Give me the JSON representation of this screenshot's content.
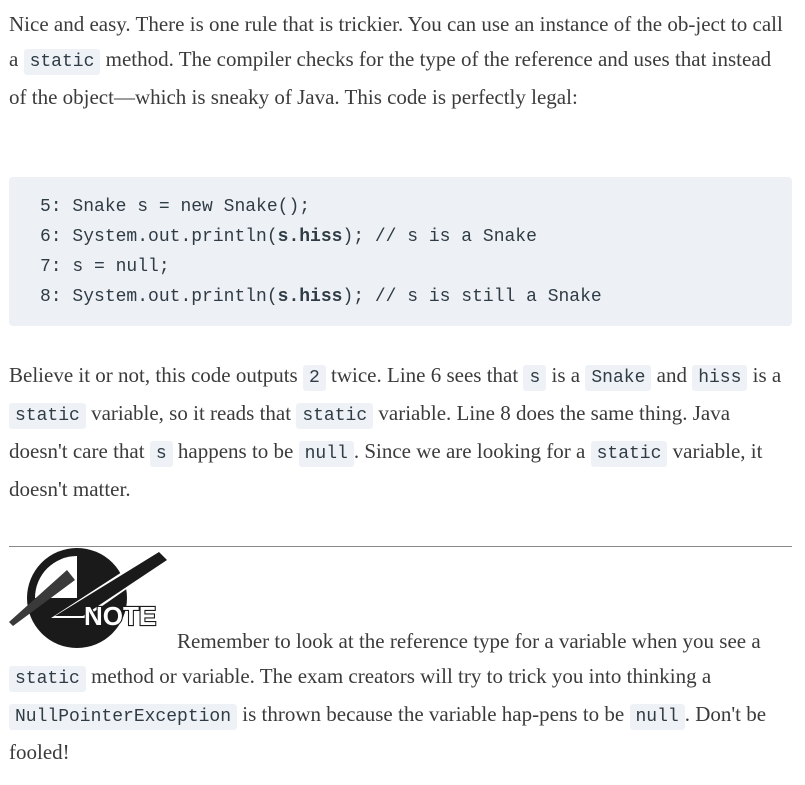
{
  "intro": {
    "t1": "Nice and easy. There is one rule that is trickier. You can use an instance of the ob-ject to call a ",
    "c1": "static",
    "t2": " method. The compiler checks for the type of the reference and uses that instead of the object—which is sneaky of Java. This code is perfectly legal:"
  },
  "code": {
    "line5": {
      "num": "5:",
      "text": "Snake s = new Snake();"
    },
    "line6": {
      "num": "6:",
      "pre": "System.out.println(",
      "bold": "s.hiss",
      "post": "); // s is a Snake"
    },
    "line7": {
      "num": "7:",
      "text": "s = null;"
    },
    "line8": {
      "num": "8:",
      "pre": "System.out.println(",
      "bold": "s.hiss",
      "post": "); // s is still a Snake"
    }
  },
  "explain": {
    "t1": "Believe it or not, this code outputs ",
    "c1": "2",
    "t2": " twice. Line 6 sees that ",
    "c2": "s",
    "t3": " is a ",
    "c3": "Snake",
    "t4": " and ",
    "c4": "hiss",
    "t5": " is a ",
    "c5": "static",
    "t6": " variable, so it reads that ",
    "c6": "static",
    "t7": " variable. Line 8 does the same thing. Java doesn't care that ",
    "c7": "s",
    "t8": " happens to be ",
    "c8": "null",
    "t9": ". Since we are looking for a ",
    "c9": "static",
    "t10": " variable, it doesn't matter."
  },
  "note": {
    "icon_label": "NOTE",
    "t1": "Remember to look at the reference type for a variable when you see a ",
    "c1": "static",
    "t2": " method or variable. The exam creators will try to trick you into thinking a ",
    "c2": "NullPointerException",
    "t3": " is thrown because the variable hap-pens to be ",
    "c3": "null",
    "t4": ". Don't be fooled!"
  }
}
